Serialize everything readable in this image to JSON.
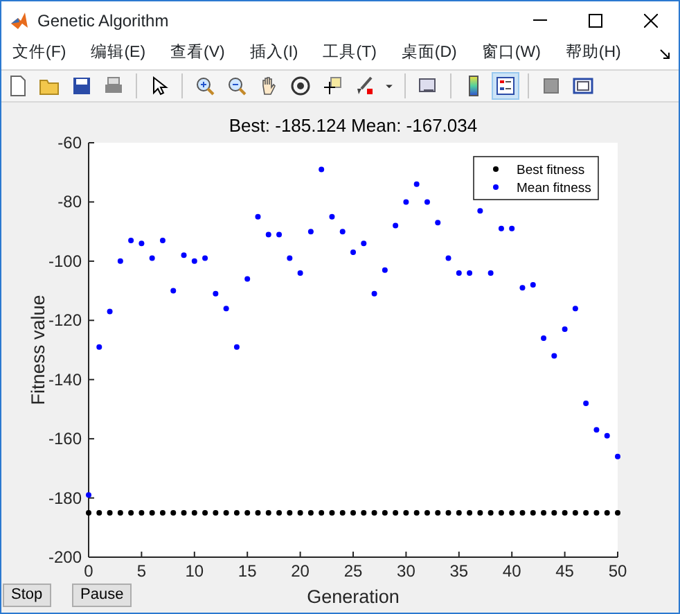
{
  "window": {
    "title": "Genetic Algorithm"
  },
  "menu": [
    "文件(F)",
    "编辑(E)",
    "查看(V)",
    "插入(I)",
    "工具(T)",
    "桌面(D)",
    "窗口(W)",
    "帮助(H)"
  ],
  "toolbar": {
    "colorbar_on": false,
    "legend_on": true
  },
  "chart": {
    "chart_data": {
      "type": "scatter",
      "legend": "upper right",
      "title": "Best: -185.124 Mean: -167.034",
      "xlabel": "Generation",
      "ylabel": "Fitness value",
      "xlim": [
        0,
        50
      ],
      "ylim": [
        -200,
        -60
      ],
      "xticks": [
        0,
        5,
        10,
        15,
        20,
        25,
        30,
        35,
        40,
        45,
        50
      ],
      "yticks": [
        -200,
        -180,
        -160,
        -140,
        -120,
        -100,
        -80,
        -60
      ],
      "x": [
        0,
        1,
        2,
        3,
        4,
        5,
        6,
        7,
        8,
        9,
        10,
        11,
        12,
        13,
        14,
        15,
        16,
        17,
        18,
        19,
        20,
        21,
        22,
        23,
        24,
        25,
        26,
        27,
        28,
        29,
        30,
        31,
        32,
        33,
        34,
        35,
        36,
        37,
        38,
        39,
        40,
        41,
        42,
        43,
        44,
        45,
        46,
        47,
        48,
        49,
        50
      ],
      "series": [
        {
          "name": "Best fitness",
          "color": "#000000",
          "values": [
            -185,
            -185,
            -185,
            -185,
            -185,
            -185,
            -185,
            -185,
            -185,
            -185,
            -185,
            -185,
            -185,
            -185,
            -185,
            -185,
            -185,
            -185,
            -185,
            -185,
            -185,
            -185,
            -185,
            -185,
            -185,
            -185,
            -185,
            -185,
            -185,
            -185,
            -185,
            -185,
            -185,
            -185,
            -185,
            -185,
            -185,
            -185,
            -185,
            -185,
            -185,
            -185,
            -185,
            -185,
            -185,
            -185,
            -185,
            -185,
            -185,
            -185,
            -185
          ]
        },
        {
          "name": "Mean fitness",
          "color": "#0000ff",
          "values": [
            -179,
            -129,
            -117,
            -100,
            -93,
            -94,
            -99,
            -93,
            -110,
            -98,
            -100,
            -99,
            -111,
            -116,
            -129,
            -106,
            -85,
            -91,
            -91,
            -99,
            -104,
            -90,
            -69,
            -85,
            -90,
            -97,
            -94,
            -111,
            -103,
            -88,
            -80,
            -74,
            -80,
            -87,
            -99,
            -104,
            -104,
            -83,
            -104,
            -89,
            -89,
            -109,
            -108,
            -126,
            -132,
            -123,
            -116,
            -148,
            -157,
            -159,
            -166
          ]
        }
      ]
    }
  },
  "buttons": [
    "Stop",
    "Pause"
  ]
}
